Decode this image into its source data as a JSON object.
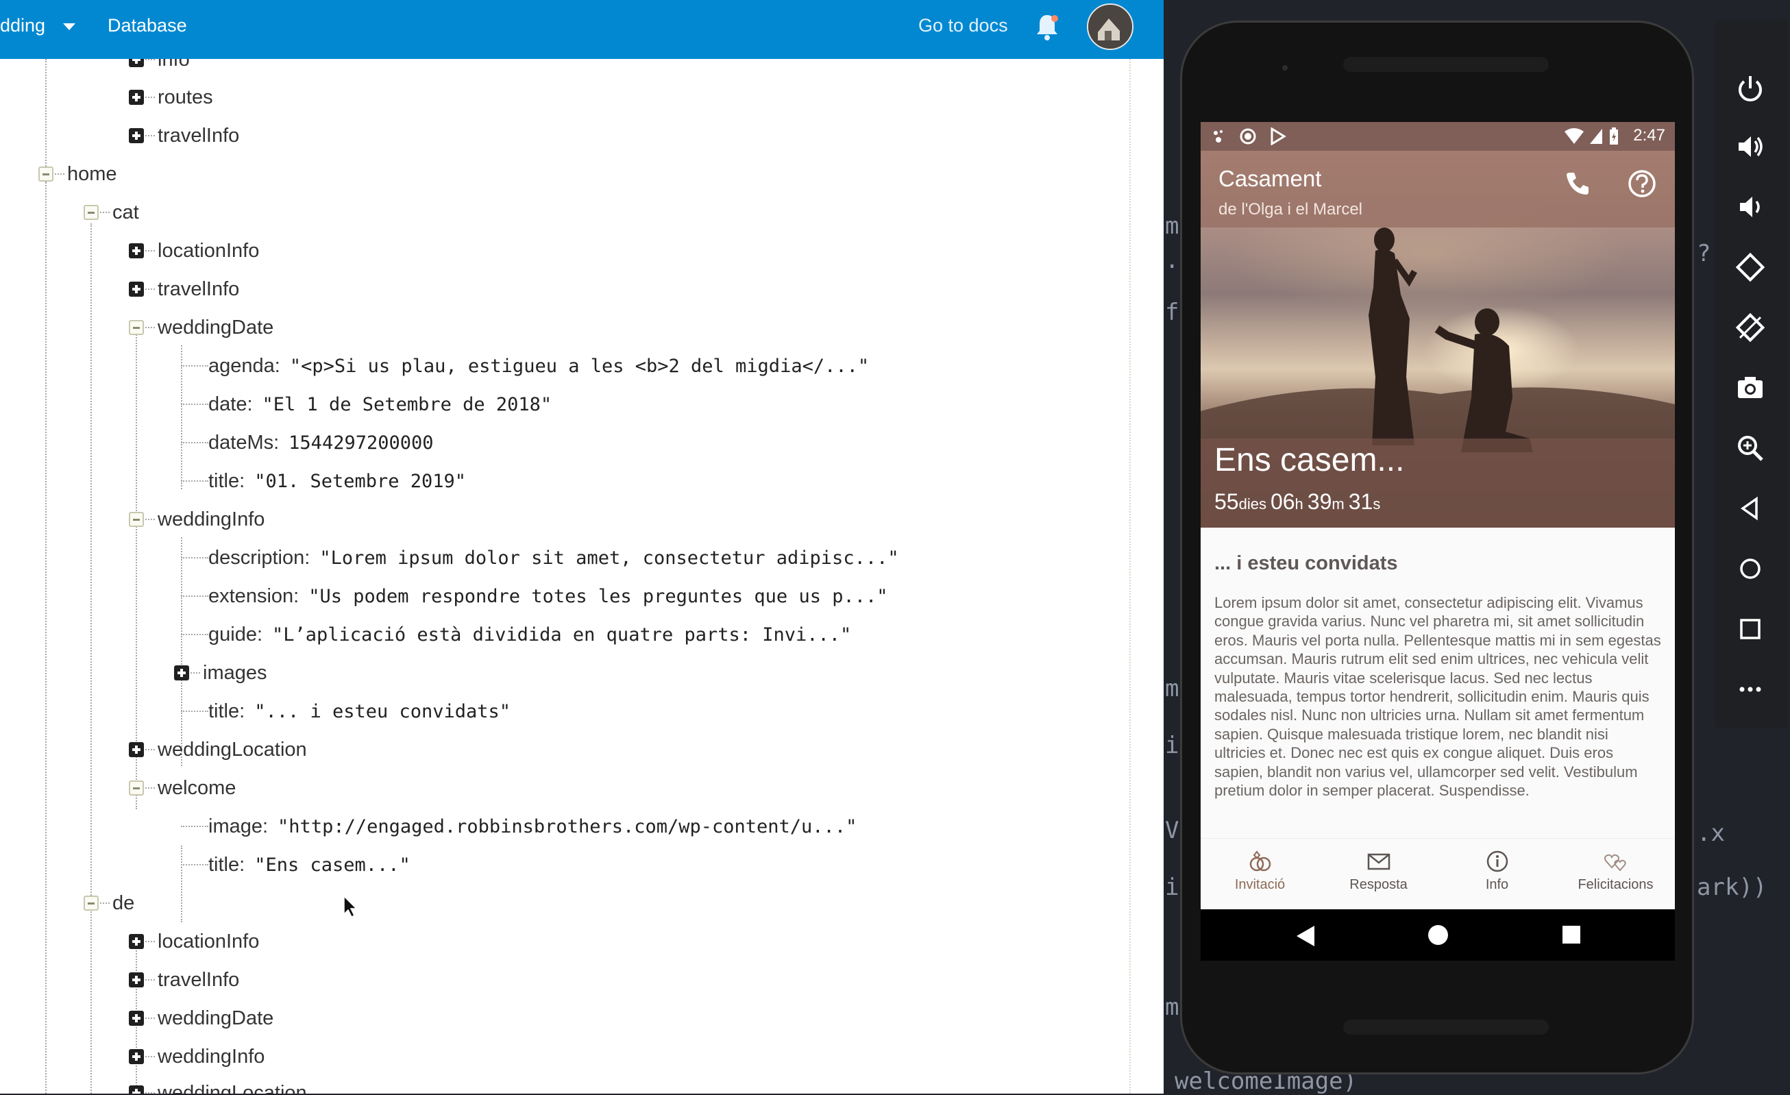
{
  "console": {
    "project_label": "dding",
    "database_tab": "Database",
    "docs_link": "Go to docs",
    "tree": {
      "partial_top": "info",
      "top_children": [
        "routes",
        "travelInfo"
      ],
      "home": {
        "label": "home",
        "cat": {
          "label": "cat",
          "locationInfo": "locationInfo",
          "travelInfo": "travelInfo",
          "weddingDate": {
            "label": "weddingDate",
            "fields": [
              {
                "key": "agenda:",
                "value": "\"<p>Si us plau, estigueu a les <b>2 del migdia</...\""
              },
              {
                "key": "date:",
                "value": "\"El 1 de Setembre de 2018\""
              },
              {
                "key": "dateMs:",
                "value": "1544297200000"
              },
              {
                "key": "title:",
                "value": "\"01. Setembre 2019\""
              }
            ]
          },
          "weddingInfo": {
            "label": "weddingInfo",
            "fields": [
              {
                "key": "description:",
                "value": "\"Lorem ipsum dolor sit amet, consectetur adipisc...\""
              },
              {
                "key": "extension:",
                "value": "\"Us podem respondre totes les preguntes que us p...\""
              },
              {
                "key": "guide:",
                "value": "\"L’aplicació està dividida en quatre parts: Invi...\""
              }
            ],
            "images": "images",
            "title_key": "title:",
            "title_value": "\"... i esteu convidats\""
          },
          "weddingLocation": "weddingLocation",
          "welcome": {
            "label": "welcome",
            "fields": [
              {
                "key": "image:",
                "value": "\"http://engaged.robbinsbrothers.com/wp-content/u...\""
              },
              {
                "key": "title:",
                "value": "\"Ens casem...\""
              }
            ]
          }
        },
        "de": {
          "label": "de",
          "children": [
            "locationInfo",
            "travelInfo",
            "weddingDate",
            "weddingInfo",
            "weddingLocation"
          ]
        }
      }
    }
  },
  "editor_fragments": [
    "m",
    ".",
    "fo",
    "?",
    "m",
    "i",
    "V",
    "i",
    "m",
    ".x",
    "ark))",
    "welcomeImage)"
  ],
  "app": {
    "status_time": "2:47",
    "title": "Casament",
    "subtitle": "de l'Olga i el Marcel",
    "headline": "Ens casem...",
    "countdown": {
      "days": "55",
      "days_unit": "dies",
      "hours": "06",
      "hours_unit": "h",
      "minutes": "39",
      "minutes_unit": "m",
      "seconds": "31",
      "seconds_unit": "s"
    },
    "section_title": "... i esteu convidats",
    "section_body": "Lorem ipsum dolor sit amet, consectetur adipiscing elit. Vivamus congue gravida varius. Nunc vel pharetra mi, sit amet sollicitudin eros. Mauris vel porta nulla. Pellentesque mattis mi in sem egestas accumsan. Mauris rutrum elit sed enim ultrices, nec vehicula velit vulputate. Mauris vitae scelerisque lacus. Sed nec lectus malesuada, tempus tortor hendrerit, sollicitudin enim. Mauris quis sodales nisl. Nunc non ultricies urna. Nullam sit amet fermentum sapien. Quisque malesuada tristique lorem, nec blandit nisi ultricies et. Donec nec est quis ex congue aliquet. Duis eros sapien, blandit non varius vel, ullamcorper sed velit. Vestibulum pretium dolor in semper placerat. Suspendisse.",
    "nav": [
      {
        "label": "Invitació",
        "icon": "rings-icon",
        "active": true
      },
      {
        "label": "Resposta",
        "icon": "mail-icon",
        "active": false
      },
      {
        "label": "Info",
        "icon": "info-icon",
        "active": false
      },
      {
        "label": "Felicitacions",
        "icon": "hearts-icon",
        "active": false
      }
    ]
  },
  "emulator_toolbar": [
    "power-icon",
    "volume-up-icon",
    "volume-down-icon",
    "rotate-left-icon",
    "rotate-right-icon",
    "camera-icon",
    "zoom-icon",
    "back-icon",
    "home-icon",
    "overview-icon",
    "more-icon"
  ],
  "colors": {
    "console_bar": "#0288d1",
    "app_brown": "#8d6a58",
    "emulator_bg": "#20232a"
  }
}
